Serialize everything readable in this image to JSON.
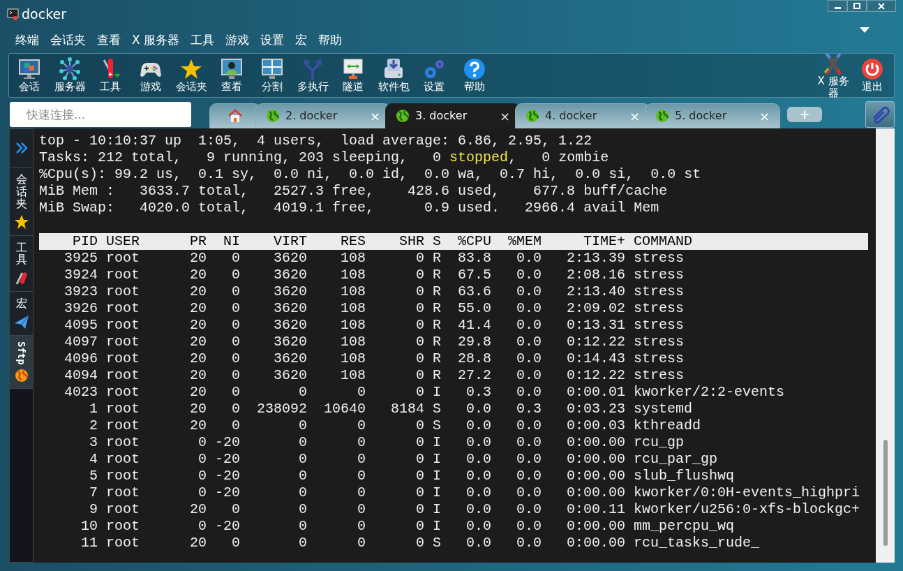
{
  "window": {
    "title": "docker"
  },
  "menu": [
    "终端",
    "会话夹",
    "查看",
    "X 服务器",
    "工具",
    "游戏",
    "设置",
    "宏",
    "帮助"
  ],
  "toolbar": [
    {
      "label": "会话"
    },
    {
      "label": "服务器"
    },
    {
      "label": "工具"
    },
    {
      "label": "游戏"
    },
    {
      "label": "会话夹"
    },
    {
      "label": "查看"
    },
    {
      "label": "分割"
    },
    {
      "label": "多执行"
    },
    {
      "label": "隧道"
    },
    {
      "label": "软件包"
    },
    {
      "label": "设置"
    },
    {
      "label": "帮助"
    }
  ],
  "toolbar_right": [
    {
      "label": "X 服务器"
    },
    {
      "label": "退出"
    }
  ],
  "quick_connect": {
    "placeholder": "快速连接..."
  },
  "tabs": [
    {
      "kind": "home",
      "selected": false
    },
    {
      "kind": "session",
      "label": "2. docker",
      "close": "×",
      "selected": false
    },
    {
      "kind": "session",
      "label": "3. docker",
      "close": "×",
      "selected": true
    },
    {
      "kind": "session",
      "label": "4. docker",
      "close": "×",
      "selected": false
    },
    {
      "kind": "session",
      "label": "5. docker",
      "close": "×",
      "selected": false
    }
  ],
  "new_tab": "+",
  "sidebar": [
    {
      "kind": "expand"
    },
    {
      "label": "会话夹",
      "selected": false
    },
    {
      "label": "工具",
      "selected": false
    },
    {
      "label": "宏",
      "selected": false
    },
    {
      "label": "Sftp",
      "selected": true
    }
  ],
  "terminal": {
    "summary": [
      [
        {
          "text": "top - 10:10:37 up  1:05,  4 users,  load average: 6.86, 2.95, 1.22",
          "highlight": false
        }
      ],
      [
        {
          "text": "Tasks: 212 total,   9 running, 203 sleeping,   0 ",
          "highlight": false
        },
        {
          "text": "stopped",
          "highlight": true
        },
        {
          "text": ",   0 zombie",
          "highlight": false
        }
      ],
      [
        {
          "text": "%Cpu(s): 99.2 us,  0.1 sy,  0.0 ni,  0.0 id,  0.0 wa,  0.7 hi,  0.0 si,  0.0 st",
          "highlight": false
        }
      ],
      [
        {
          "text": "MiB Mem :   3633.7 total,   2527.3 free,    428.6 used,    677.8 buff/cache",
          "highlight": false
        }
      ],
      [
        {
          "text": "MiB Swap:   4020.0 total,   4019.1 free,      0.9 used.   2966.4 avail Mem",
          "highlight": false
        }
      ]
    ],
    "columns": [
      "PID",
      "USER",
      "PR",
      "NI",
      "VIRT",
      "RES",
      "SHR",
      "S",
      "%CPU",
      "%MEM",
      "TIME+",
      "COMMAND"
    ],
    "rows": [
      [
        "3925",
        "root",
        "20",
        "0",
        "3620",
        "108",
        "0",
        "R",
        "83.8",
        "0.0",
        "2:13.39",
        "stress"
      ],
      [
        "3924",
        "root",
        "20",
        "0",
        "3620",
        "108",
        "0",
        "R",
        "67.5",
        "0.0",
        "2:08.16",
        "stress"
      ],
      [
        "3923",
        "root",
        "20",
        "0",
        "3620",
        "108",
        "0",
        "R",
        "63.6",
        "0.0",
        "2:13.40",
        "stress"
      ],
      [
        "3926",
        "root",
        "20",
        "0",
        "3620",
        "108",
        "0",
        "R",
        "55.0",
        "0.0",
        "2:09.02",
        "stress"
      ],
      [
        "4095",
        "root",
        "20",
        "0",
        "3620",
        "108",
        "0",
        "R",
        "41.4",
        "0.0",
        "0:13.31",
        "stress"
      ],
      [
        "4097",
        "root",
        "20",
        "0",
        "3620",
        "108",
        "0",
        "R",
        "29.8",
        "0.0",
        "0:12.22",
        "stress"
      ],
      [
        "4096",
        "root",
        "20",
        "0",
        "3620",
        "108",
        "0",
        "R",
        "28.8",
        "0.0",
        "0:14.43",
        "stress"
      ],
      [
        "4094",
        "root",
        "20",
        "0",
        "3620",
        "108",
        "0",
        "R",
        "27.2",
        "0.0",
        "0:12.22",
        "stress"
      ],
      [
        "4023",
        "root",
        "20",
        "0",
        "0",
        "0",
        "0",
        "I",
        "0.3",
        "0.0",
        "0:00.01",
        "kworker/2:2-events"
      ],
      [
        "1",
        "root",
        "20",
        "0",
        "238092",
        "10640",
        "8184",
        "S",
        "0.0",
        "0.3",
        "0:03.23",
        "systemd"
      ],
      [
        "2",
        "root",
        "20",
        "0",
        "0",
        "0",
        "0",
        "S",
        "0.0",
        "0.0",
        "0:00.03",
        "kthreadd"
      ],
      [
        "3",
        "root",
        "0",
        "-20",
        "0",
        "0",
        "0",
        "I",
        "0.0",
        "0.0",
        "0:00.00",
        "rcu_gp"
      ],
      [
        "4",
        "root",
        "0",
        "-20",
        "0",
        "0",
        "0",
        "I",
        "0.0",
        "0.0",
        "0:00.00",
        "rcu_par_gp"
      ],
      [
        "5",
        "root",
        "0",
        "-20",
        "0",
        "0",
        "0",
        "I",
        "0.0",
        "0.0",
        "0:00.00",
        "slub_flushwq"
      ],
      [
        "7",
        "root",
        "0",
        "-20",
        "0",
        "0",
        "0",
        "I",
        "0.0",
        "0.0",
        "0:00.00",
        "kworker/0:0H-events_highpri"
      ],
      [
        "9",
        "root",
        "20",
        "0",
        "0",
        "0",
        "0",
        "I",
        "0.0",
        "0.0",
        "0:00.11",
        "kworker/u256:0-xfs-blockgc+"
      ],
      [
        "10",
        "root",
        "0",
        "-20",
        "0",
        "0",
        "0",
        "I",
        "0.0",
        "0.0",
        "0:00.00",
        "mm_percpu_wq"
      ],
      [
        "11",
        "root",
        "20",
        "0",
        "0",
        "0",
        "0",
        "S",
        "0.0",
        "0.0",
        "0:00.00",
        "rcu_tasks_rude_"
      ]
    ]
  }
}
